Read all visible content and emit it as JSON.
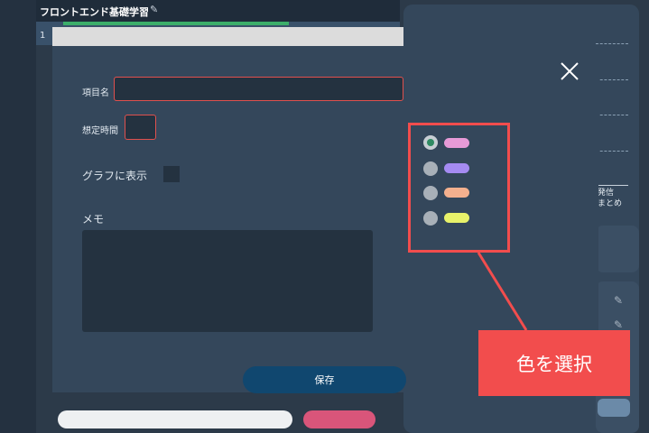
{
  "header": {
    "title": "フロントエンド基礎学習",
    "line_number": "1"
  },
  "modal": {
    "item_name_label": "項目名",
    "time_label": "想定時間",
    "graph_label": "グラフに表示",
    "memo_label": "メモ",
    "save_label": "保存"
  },
  "color_options": [
    {
      "color": "#e79ad7",
      "selected": true
    },
    {
      "color": "#a58bf2",
      "selected": false
    },
    {
      "color": "#f4b08e",
      "selected": false
    },
    {
      "color": "#e8f26a",
      "selected": false
    }
  ],
  "right_panel": {
    "text_line1": "発信",
    "text_line2": "まとめ"
  },
  "callout": {
    "text": "色を選択",
    "color": "#f24d4d"
  }
}
